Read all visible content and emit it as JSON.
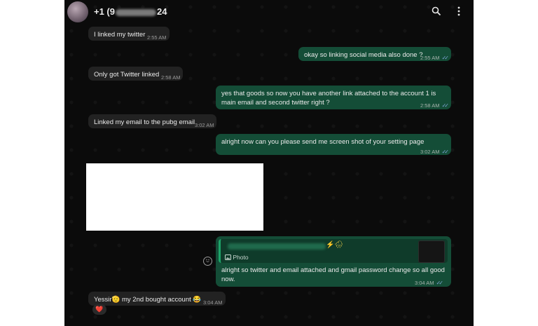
{
  "header": {
    "name_prefix": "+1 (9",
    "name_suffix": "24",
    "search_icon": "search-icon",
    "menu_icon": "more-vertical-icon"
  },
  "messages": [
    {
      "direction": "in",
      "text": "I linked my twitter",
      "time": "2:55 AM"
    },
    {
      "direction": "out",
      "text": "okay so linking social media also done ?",
      "time": "2:55 AM",
      "status": "read"
    },
    {
      "direction": "in",
      "text": "Only got Twitter linked",
      "time": "2:58 AM"
    },
    {
      "direction": "out",
      "text": "yes that goods so now you have another link attached to the account 1 is main email and second twitter right ?",
      "time": "2:58 AM",
      "status": "read"
    },
    {
      "direction": "in",
      "text": "Linked my email to the pubg email",
      "time": "3:02 AM"
    },
    {
      "direction": "out",
      "text": "alright now can you please send me screen shot of your setting page",
      "time": "3:02 AM",
      "status": "read"
    },
    {
      "direction": "out",
      "quote_label": "Photo",
      "text": "alright so twitter and email attached and gmail password change so all good now.",
      "time": "3:04 AM",
      "status": "read"
    },
    {
      "direction": "in",
      "text": "Yessir🫡 my 2nd bought account 😂",
      "time": "3:04 AM",
      "reaction": "❤️"
    }
  ],
  "ticks": "✓✓",
  "quote_emoji": "⚡🌧",
  "reaction": "❤",
  "colors": {
    "incoming": "#222222",
    "outgoing": "#144d37",
    "background": "#0b0b0b",
    "read_ticks": "#7fa5d6"
  }
}
